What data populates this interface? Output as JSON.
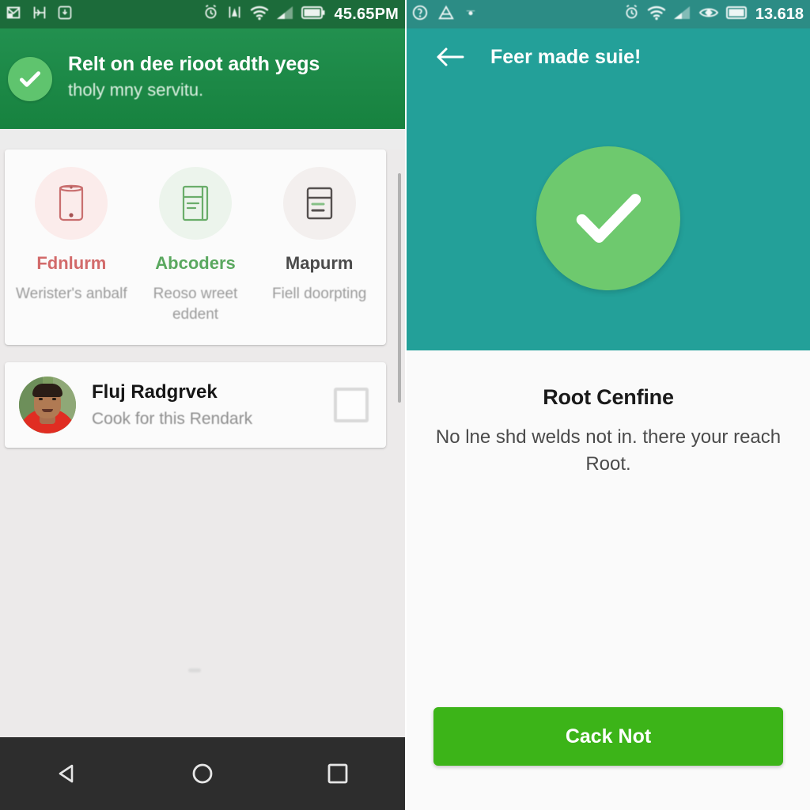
{
  "left_screen": {
    "status_bar": {
      "time": "45.65PM",
      "notification_icons": [
        "mail-icon",
        "sync-icon",
        "download-icon"
      ],
      "system_icons": [
        "alarm-icon",
        "signal-alt-icon",
        "wifi-icon",
        "cellular-signal-icon",
        "battery-icon"
      ],
      "background_color": "#1c6b3a"
    },
    "banner": {
      "icon": "check-circle-icon",
      "title": "Relt on dee rioot adth yegs",
      "subtitle": "tholy mny servitu.",
      "background_color": "#1d8a4c"
    },
    "features_card": {
      "items": [
        {
          "icon": "phone-outline-icon",
          "title": "Fdnlurm",
          "description": "Werister's anbalf",
          "color": "#d26a6a",
          "badge_color": "#fbeceb"
        },
        {
          "icon": "notebook-icon",
          "title": "Abcoders",
          "description": "Reoso wreet eddent",
          "color": "#5aa85f",
          "badge_color": "#ecf4ec"
        },
        {
          "icon": "card-list-icon",
          "title": "Mapurm",
          "description": "Fiell doorpting",
          "color": "#4b4b4b",
          "badge_color": "#f3efee"
        }
      ]
    },
    "person_card": {
      "avatar": "user-photo-avatar",
      "name": "Fluj Radgrvek",
      "subtitle": "Cook for this Rendark",
      "checkbox": "unchecked-checkbox"
    },
    "nav_bar": {
      "back": "back-triangle-icon",
      "home": "home-circle-icon",
      "recents": "recents-square-icon",
      "background_color": "#2d2d2d"
    }
  },
  "right_screen": {
    "status_bar": {
      "time": "13.618",
      "notification_icons": [
        "app-icon",
        "warning-icon",
        "dot-icon"
      ],
      "system_icons": [
        "alarm-icon",
        "wifi-icon",
        "cellular-signal-icon",
        "eye-icon",
        "battery-icon"
      ],
      "background_color": "#2c8c85"
    },
    "app_bar": {
      "back_icon": "back-arrow-icon",
      "title": "Feer made suie!",
      "background_color": "#23a099"
    },
    "hero": {
      "icon": "check-circle-icon",
      "circle_color": "#6ec96e",
      "background_color": "#23a099"
    },
    "result": {
      "title": "Root Cenfine",
      "description": "No lne shd welds not in. there your reach Root."
    },
    "cta": {
      "label": "Cack Not",
      "color": "#3cb418"
    }
  }
}
